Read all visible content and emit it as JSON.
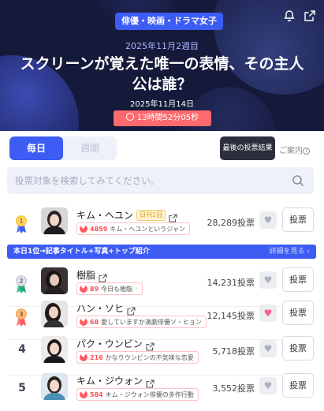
{
  "hero": {
    "category": "俳優・映画・ドラマ女子",
    "week": "2025年11月2週目",
    "title": "スクリーンが覚えた唯一の表情、その主人公は誰？",
    "date": "2025年11月14日",
    "countdown": "13時間52分05秒",
    "icons": [
      "bell-icon",
      "share-icon"
    ]
  },
  "tabs": {
    "daily": "毎日",
    "weekly": "週間"
  },
  "last_result_label": "最後の投票結果",
  "guide_label": "ご案内",
  "search": {
    "placeholder": "投票対象を検索してみてください。"
  },
  "vote_label": "投票",
  "banner": {
    "text": "本日1位→記事タイトル+写真+トップ紹介",
    "more": "詳細を見る ›"
  },
  "ranking": [
    {
      "rank": "1",
      "name": "キム・ヘユン",
      "badge": "日刊1冠",
      "chip_count": "4859",
      "chip_text": "キム・ヘユンというジャン",
      "votes": "28,289投票",
      "liked": false
    },
    {
      "rank": "2",
      "name": "樹脂",
      "chip_count": "89",
      "chip_text": "今日も樹脂",
      "votes": "14,231投票",
      "liked": false
    },
    {
      "rank": "3",
      "name": "ハン・ソヒ",
      "chip_count": "68",
      "chip_text": "愛していますか演劇俳優ソ・ヒョン",
      "votes": "12,145投票",
      "liked": true
    },
    {
      "rank": "4",
      "name": "パク・ウンビン",
      "chip_count": "216",
      "chip_text": "かなりウンビンの不気味な恋愛",
      "votes": "5,718投票",
      "liked": false
    },
    {
      "rank": "5",
      "name": "キム・ジウォン",
      "chip_count": "584",
      "chip_text": "キム・ジウォン俳優の多作行動",
      "votes": "3,552投票",
      "liked": false
    }
  ],
  "colors": {
    "accent": "#3d5cf3",
    "hero_bg": "#15193a",
    "countdown": "#ff6a6f",
    "like": "#ff5b63"
  }
}
